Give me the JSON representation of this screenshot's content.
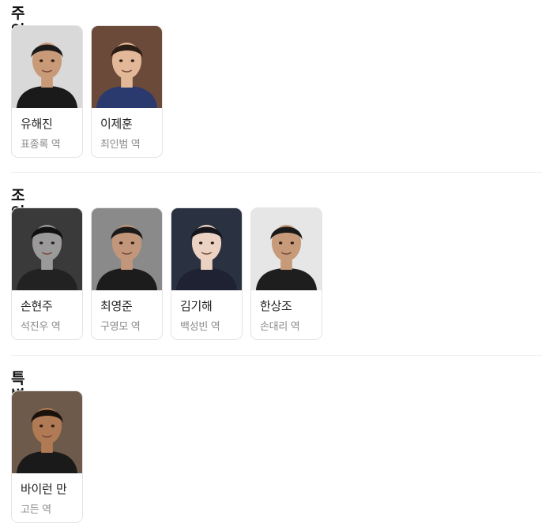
{
  "sections": [
    {
      "title": "주연",
      "cast": [
        {
          "name": "유해진",
          "role": "표종록 역",
          "bg": "#d9d9d9",
          "hair": "#1b1b1b",
          "skin": "#c89a78",
          "shirt": "#1a1a1a"
        },
        {
          "name": "이제훈",
          "role": "최인범 역",
          "bg": "#6b4a3a",
          "hair": "#2a1d16",
          "skin": "#e2b898",
          "shirt": "#2b3a6e"
        }
      ]
    },
    {
      "title": "조연",
      "cast": [
        {
          "name": "손현주",
          "role": "석진우 역",
          "bg": "#3a3a3a",
          "hair": "#111111",
          "skin": "#9a9a9a",
          "shirt": "#222222"
        },
        {
          "name": "최영준",
          "role": "구영모 역",
          "bg": "#8a8a8a",
          "hair": "#1a1a1a",
          "skin": "#c2967a",
          "shirt": "#1c1c1c"
        },
        {
          "name": "김기해",
          "role": "백성빈 역",
          "bg": "#2a3140",
          "hair": "#15161c",
          "skin": "#ecd2c2",
          "shirt": "#1f2233"
        },
        {
          "name": "한상조",
          "role": "손대리 역",
          "bg": "#e6e6e6",
          "hair": "#1a1a1a",
          "skin": "#c79a7a",
          "shirt": "#1e1e1e"
        }
      ]
    },
    {
      "title": "특별출연",
      "cast": [
        {
          "name": "바이런 만",
          "role": "고든 역",
          "bg": "#6e5a4a",
          "hair": "#1a120d",
          "skin": "#b07a55",
          "shirt": "#1a1a1a"
        }
      ]
    }
  ]
}
